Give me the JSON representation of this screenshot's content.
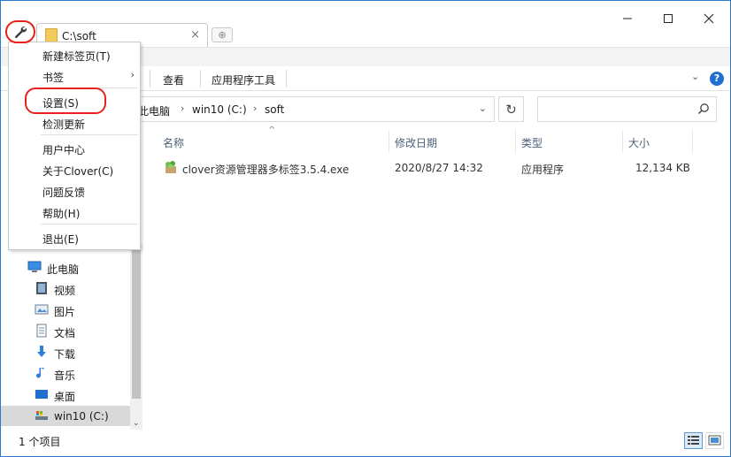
{
  "window": {
    "tab_title": "C:\\soft",
    "tab_close": "×",
    "new_tab": "⊕"
  },
  "ribbon": {
    "tabs": [
      "查看",
      "应用程序工具"
    ],
    "collapse_glyph": "⌄",
    "help_label": "?"
  },
  "address": {
    "crumbs": [
      "此电脑",
      "win10 (C:)",
      "soft"
    ],
    "separator": "›",
    "dropdown": "⌄",
    "refresh": "↻",
    "search_placeholder": ""
  },
  "columns": {
    "name": "名称",
    "modified": "修改日期",
    "type": "类型",
    "size": "大小",
    "sort_glyph": "^"
  },
  "files": [
    {
      "name": "clover资源管理器多标签3.5.4.exe",
      "modified": "2020/8/27 14:32",
      "type": "应用程序",
      "size": "12,134 KB",
      "icon": "clover-app-icon"
    }
  ],
  "nav": {
    "items": [
      {
        "label": "此电脑",
        "icon": "computer-icon"
      },
      {
        "label": "视频",
        "icon": "video-icon"
      },
      {
        "label": "图片",
        "icon": "picture-icon"
      },
      {
        "label": "文档",
        "icon": "document-icon"
      },
      {
        "label": "下载",
        "icon": "download-icon"
      },
      {
        "label": "音乐",
        "icon": "music-icon"
      },
      {
        "label": "桌面",
        "icon": "desktop-icon"
      },
      {
        "label": "win10 (C:)",
        "icon": "drive-icon",
        "selected": true
      }
    ],
    "scroll_down": "⌄"
  },
  "status": {
    "item_count": "1 个项目"
  },
  "menu": {
    "items": [
      {
        "label": "新建标签页(T)"
      },
      {
        "label": "书签",
        "submenu_arrow": "›"
      },
      {
        "label": "设置(S)",
        "highlighted_annotation": true
      },
      {
        "label": "检测更新"
      },
      {
        "label": "用户中心"
      },
      {
        "label": "关于Clover(C)"
      },
      {
        "label": "问题反馈"
      },
      {
        "label": "帮助(H)"
      },
      {
        "label": "退出(E)"
      }
    ]
  },
  "colors": {
    "annotation_red": "#e8211b",
    "window_border": "#2b7bd0",
    "folder_yellow": "#f3cb5c",
    "help_blue": "#1f6fd1"
  }
}
